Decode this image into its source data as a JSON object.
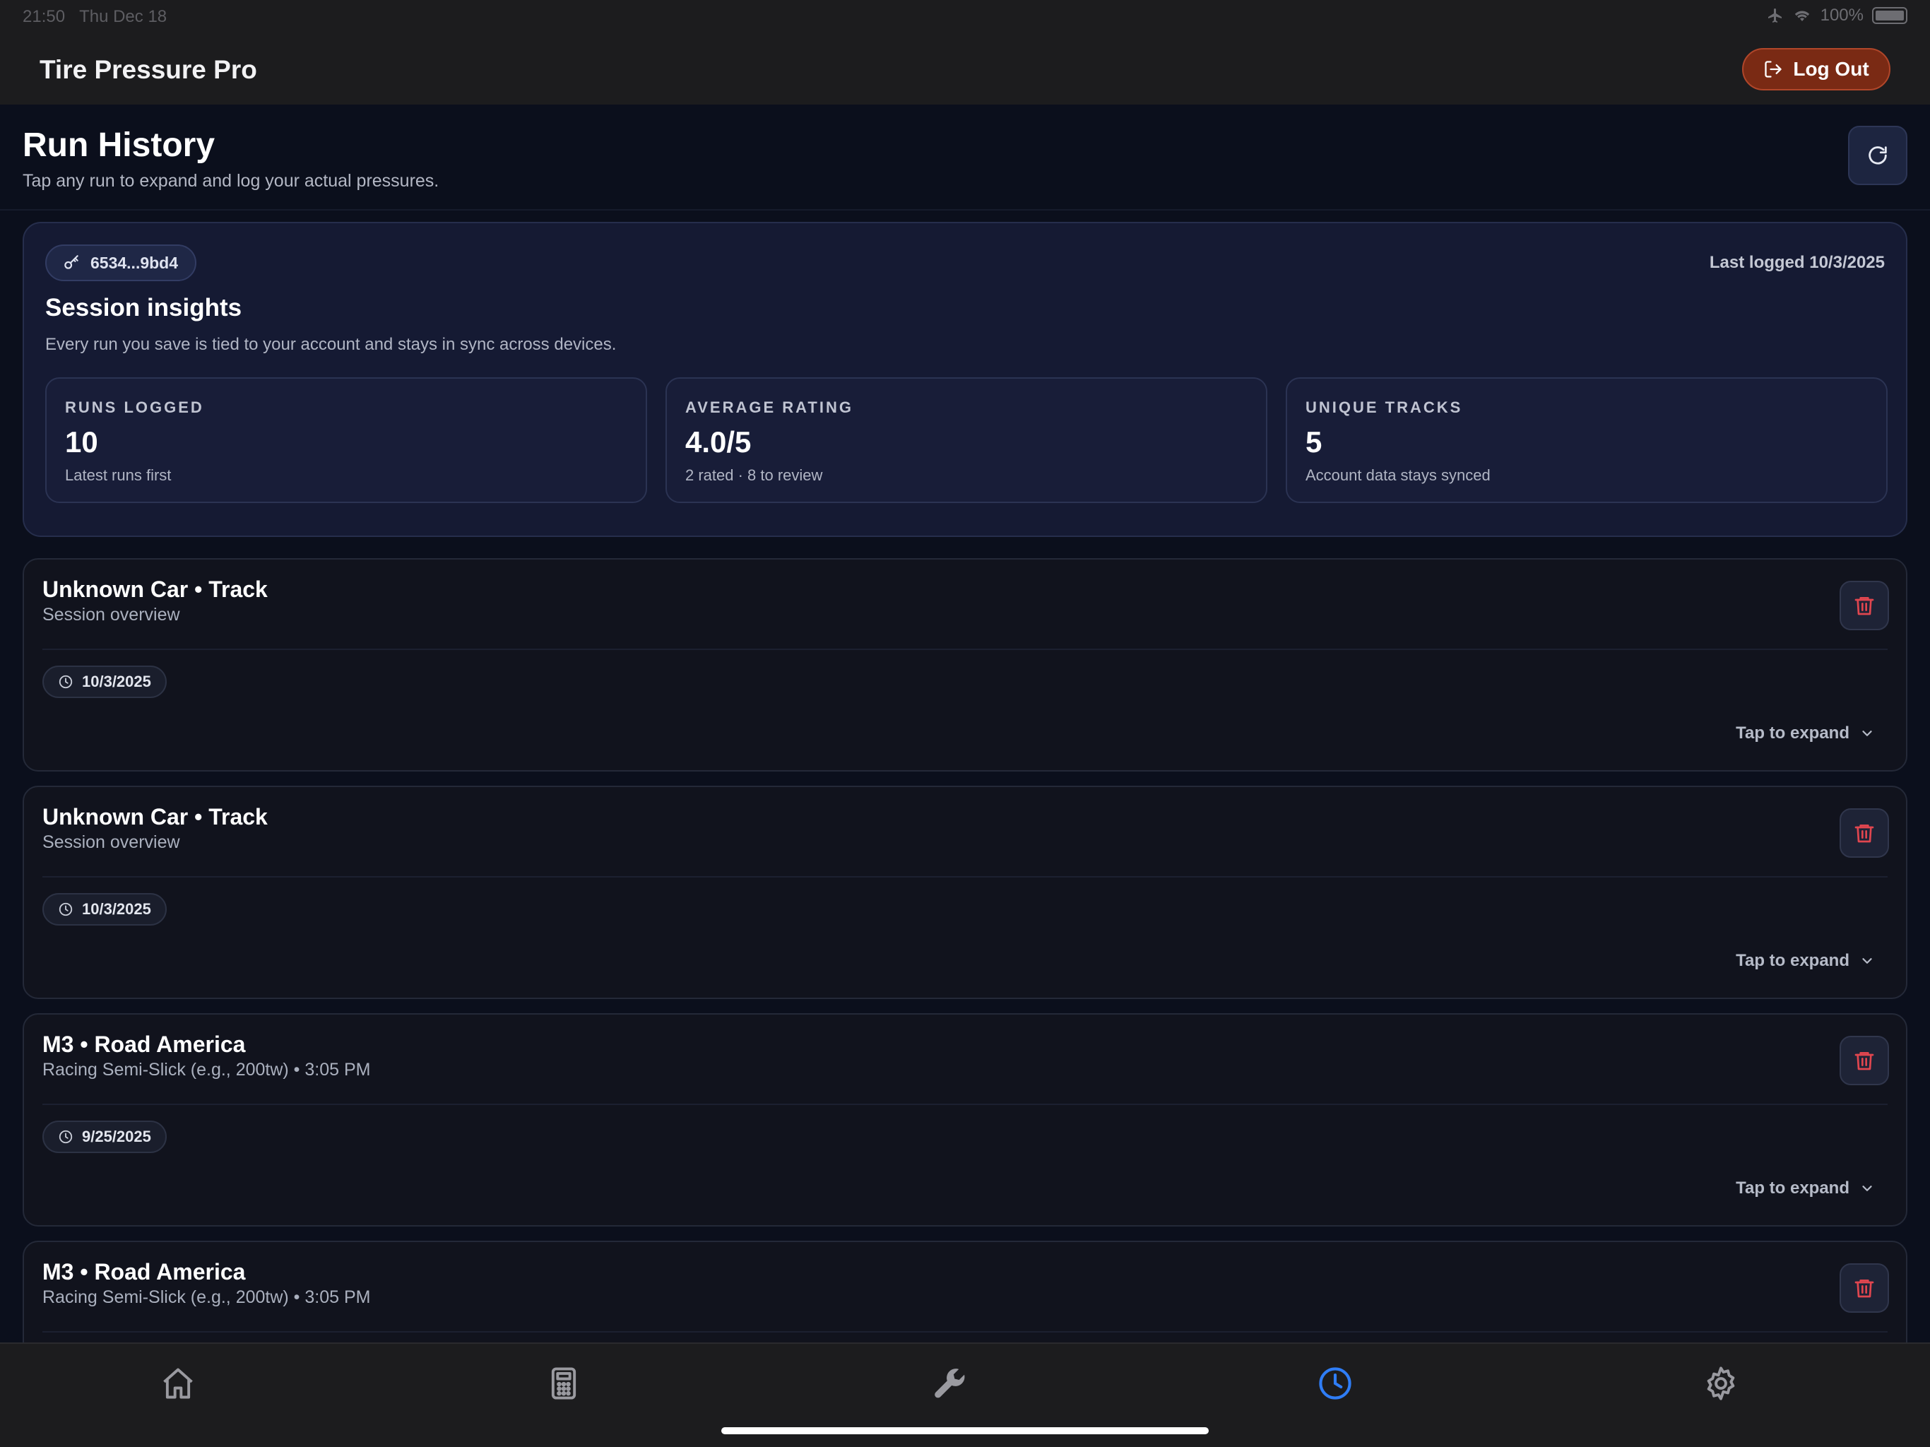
{
  "status_bar": {
    "time": "21:50",
    "date": "Thu Dec 18",
    "battery": "100%"
  },
  "app": {
    "title": "Tire Pressure Pro",
    "logout_label": "Log Out"
  },
  "page": {
    "title": "Run History",
    "subtitle": "Tap any run to expand and log your actual pressures."
  },
  "insights": {
    "key_id": "6534...9bd4",
    "last_logged": "Last logged 10/3/2025",
    "title": "Session insights",
    "subtitle": "Every run you save is tied to your account and stays in sync across devices.",
    "stats": [
      {
        "label": "RUNS LOGGED",
        "value": "10",
        "note": "Latest runs first"
      },
      {
        "label": "AVERAGE RATING",
        "value": "4.0/5",
        "note": "2 rated · 8 to review"
      },
      {
        "label": "UNIQUE TRACKS",
        "value": "5",
        "note": "Account data stays synced"
      }
    ]
  },
  "runs": [
    {
      "title": "Unknown Car • Track",
      "subtitle": "Session overview",
      "date": "10/3/2025",
      "expand_label": "Tap to expand"
    },
    {
      "title": "Unknown Car • Track",
      "subtitle": "Session overview",
      "date": "10/3/2025",
      "expand_label": "Tap to expand"
    },
    {
      "title": "M3 • Road America",
      "subtitle": "Racing Semi-Slick (e.g., 200tw) • 3:05 PM",
      "date": "9/25/2025",
      "expand_label": "Tap to expand"
    },
    {
      "title": "M3 • Road America",
      "subtitle": "Racing Semi-Slick (e.g., 200tw) • 3:05 PM",
      "date": "",
      "expand_label": ""
    }
  ],
  "tabs": [
    {
      "icon": "home-icon",
      "active": false
    },
    {
      "icon": "calculator-icon",
      "active": false
    },
    {
      "icon": "wrench-icon",
      "active": false
    },
    {
      "icon": "clock-icon",
      "active": true
    },
    {
      "icon": "gear-icon",
      "active": false
    }
  ],
  "colors": {
    "background": "#0b0f1c",
    "logout": "#7a2a14",
    "trash": "#e0464f",
    "active_tab": "#2f7df6",
    "inactive_tab": "#9a9aa0"
  }
}
